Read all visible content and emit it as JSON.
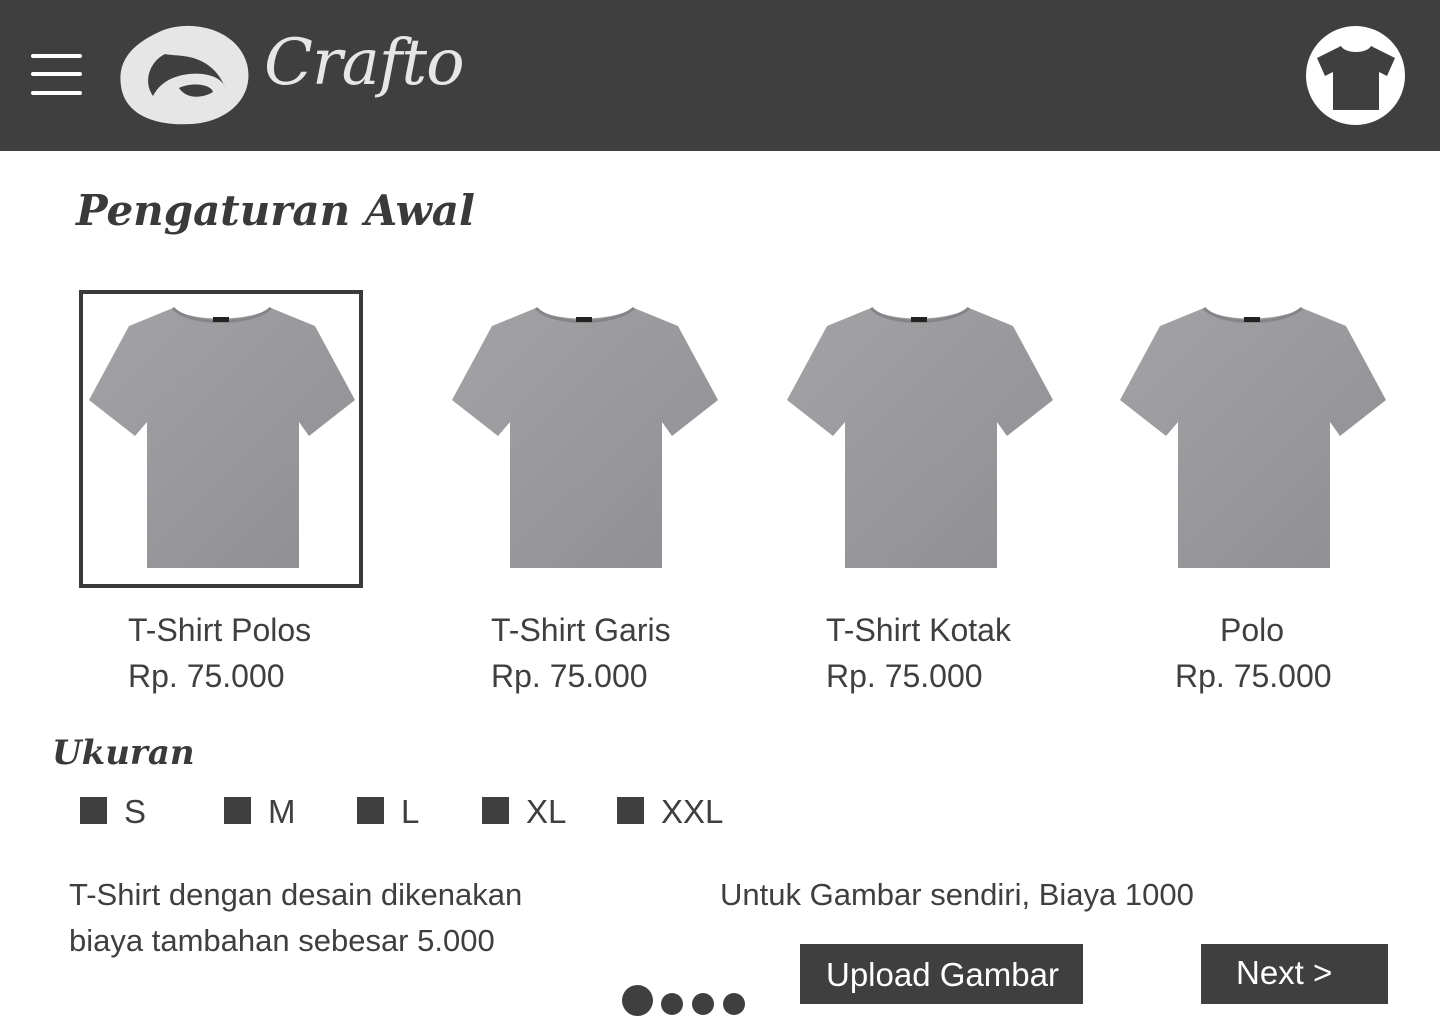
{
  "header": {
    "logo_text": "Crafto",
    "menu_icon": "hamburger-menu-icon",
    "shirt_icon": "tshirt-icon",
    "brand_color": "#3f3f3f"
  },
  "page_title": "Pengaturan Awal",
  "products": [
    {
      "name": "T-Shirt Polos",
      "price": "Rp. 75.000",
      "selected": true
    },
    {
      "name": "T-Shirt Garis",
      "price": "Rp. 75.000",
      "selected": false
    },
    {
      "name": "T-Shirt Kotak",
      "price": "Rp. 75.000",
      "selected": false
    },
    {
      "name": "Polo",
      "price": "Rp. 75.000",
      "selected": false
    }
  ],
  "size": {
    "title": "Ukuran",
    "options": [
      "S",
      "M",
      "L",
      "XL",
      "XXL"
    ]
  },
  "notes": {
    "design_fee_line1": "T-Shirt dengan desain dikenakan",
    "design_fee_line2": "biaya tambahan sebesar 5.000",
    "own_image_fee": "Untuk Gambar sendiri, Biaya 1000"
  },
  "buttons": {
    "upload": "Upload Gambar",
    "next": "Next >"
  },
  "pagination": {
    "total": 4,
    "current": 1
  }
}
